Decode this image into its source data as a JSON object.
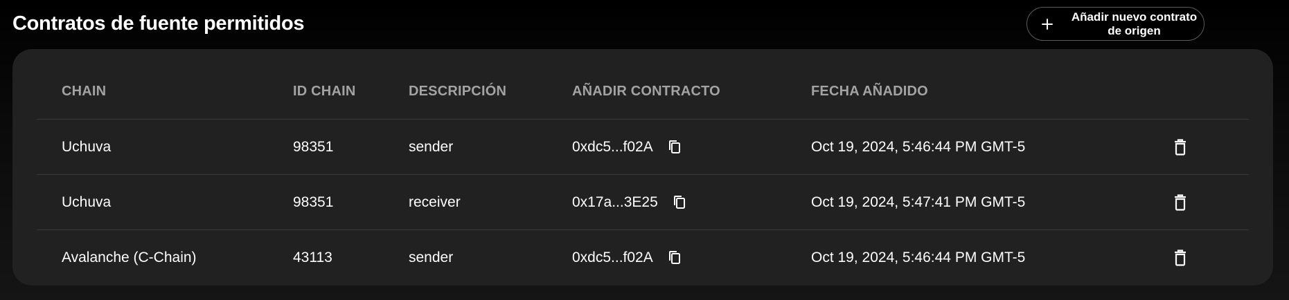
{
  "header": {
    "title": "Contratos de fuente permitidos",
    "add_button_label": "Añadir nuevo contrato de origen"
  },
  "table": {
    "columns": {
      "chain": "CHAIN",
      "chain_id": "ID CHAIN",
      "description": "DESCRIPCIÓN",
      "contract": "AÑADIR CONTRACTO",
      "date_added": "FECHA AÑADIDO"
    },
    "rows": [
      {
        "chain": "Uchuva",
        "chain_id": "98351",
        "description": "sender",
        "contract": "0xdc5...f02A",
        "date_added": "Oct 19, 2024, 5:46:44 PM GMT-5"
      },
      {
        "chain": "Uchuva",
        "chain_id": "98351",
        "description": "receiver",
        "contract": "0x17a...3E25",
        "date_added": "Oct 19, 2024, 5:47:41 PM GMT-5"
      },
      {
        "chain": "Avalanche (C-Chain)",
        "chain_id": "43113",
        "description": "sender",
        "contract": "0xdc5...f02A",
        "date_added": "Oct 19, 2024, 5:46:44 PM GMT-5"
      }
    ]
  },
  "icons": {
    "add": "plus-icon",
    "copy": "copy-icon",
    "delete": "trash-icon"
  }
}
